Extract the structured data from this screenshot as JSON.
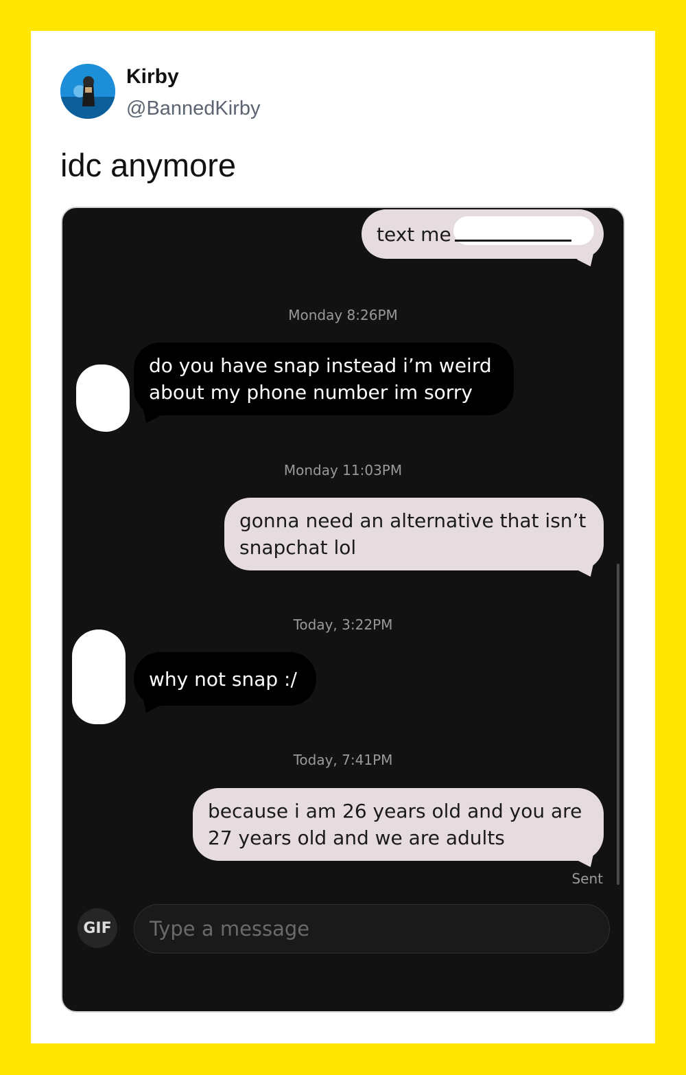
{
  "tweet": {
    "author_name": "Kirby",
    "author_handle": "@BannedKirby",
    "text": "idc anymore"
  },
  "chat": {
    "messages": [
      {
        "direction": "outgoing",
        "text": "text me"
      },
      {
        "timestamp": "Monday 8:26PM"
      },
      {
        "direction": "incoming",
        "text": "do you have snap instead i’m weird\nabout my phone number im sorry"
      },
      {
        "timestamp": "Monday 11:03PM"
      },
      {
        "direction": "outgoing",
        "text": "gonna need an alternative that isn’t\nsnapchat lol"
      },
      {
        "timestamp": "Today, 3:22PM"
      },
      {
        "direction": "incoming",
        "text": "why not snap :/"
      },
      {
        "timestamp": "Today, 7:41PM"
      },
      {
        "direction": "outgoing",
        "text": "because i am 26 years old and you are\n27 years old and we are adults"
      }
    ],
    "status": "Sent",
    "composer": {
      "gif_label": "GIF",
      "placeholder": "Type a message"
    }
  },
  "colors": {
    "frame": "#ffe600",
    "chat_background": "#121212",
    "outgoing_bubble": "#e6dcdf",
    "incoming_bubble": "#000000"
  },
  "icons": [
    "profile-avatar",
    "gif-icon"
  ]
}
